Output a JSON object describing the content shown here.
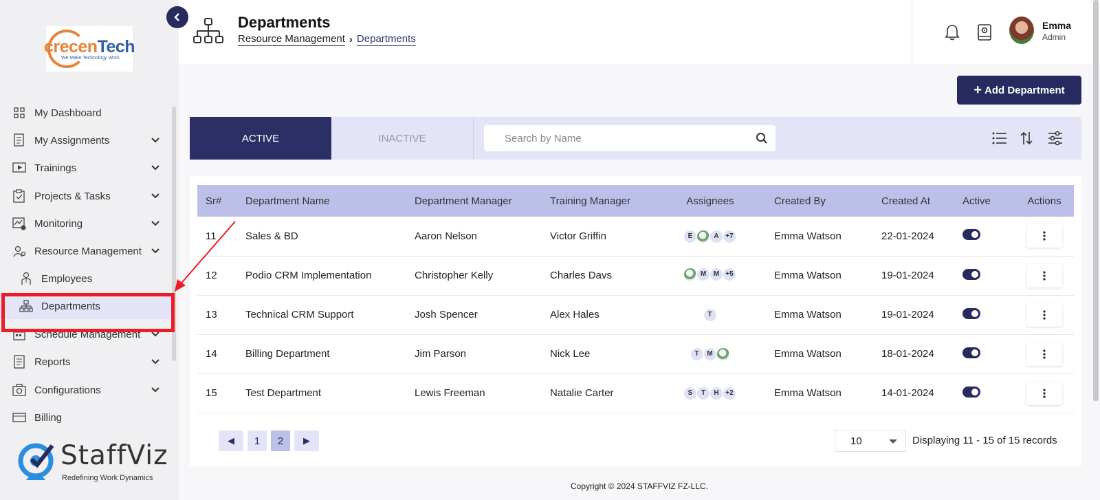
{
  "brand": {
    "logo_primary": "recen",
    "logo_secondary": "Tech",
    "logo_letter": "c",
    "logo_tagline": "We Make Technology Work",
    "footer_brand": "StaffViz",
    "footer_tagline": "Redefining Work Dynamics"
  },
  "sidebar": {
    "items": [
      {
        "label": "My Dashboard",
        "icon": "dashboard-icon",
        "expandable": false
      },
      {
        "label": "My Assignments",
        "icon": "assignments-icon",
        "expandable": true
      },
      {
        "label": "Trainings",
        "icon": "trainings-icon",
        "expandable": true
      },
      {
        "label": "Projects & Tasks",
        "icon": "projects-icon",
        "expandable": true
      },
      {
        "label": "Monitoring",
        "icon": "monitoring-icon",
        "expandable": true
      },
      {
        "label": "Resource Management",
        "icon": "resource-icon",
        "expandable": true
      },
      {
        "label": "Employees",
        "icon": "employee-icon",
        "expandable": false,
        "sub": true
      },
      {
        "label": "Departments",
        "icon": "department-icon",
        "expandable": false,
        "sub": true,
        "active": true
      },
      {
        "label": "Schedule Management",
        "icon": "schedule-icon",
        "expandable": true
      },
      {
        "label": "Reports",
        "icon": "reports-icon",
        "expandable": true
      },
      {
        "label": "Configurations",
        "icon": "configurations-icon",
        "expandable": true
      },
      {
        "label": "Billing",
        "icon": "billing-icon",
        "expandable": false
      }
    ]
  },
  "header": {
    "title": "Departments",
    "breadcrumb": [
      "Resource Management",
      "Departments"
    ],
    "user_name": "Emma",
    "user_role": "Admin"
  },
  "toolbar": {
    "add_label": "Add Department",
    "tab_active": "ACTIVE",
    "tab_inactive": "INACTIVE",
    "search_placeholder": "Search by Name"
  },
  "table": {
    "columns": [
      "Sr#",
      "Department Name",
      "Department Manager",
      "Training Manager",
      "Assignees",
      "Created By",
      "Created At",
      "Active",
      "Actions"
    ],
    "rows": [
      {
        "sr": "11",
        "name": "Sales & BD",
        "dept_manager": "Aaron Nelson",
        "training_manager": "Victor Griffin",
        "assignees": [
          "E",
          "img",
          "A",
          "+7"
        ],
        "created_by": "Emma Watson",
        "created_at": "22-01-2024",
        "active": true
      },
      {
        "sr": "12",
        "name": "Podio CRM Implementation",
        "dept_manager": "Christopher Kelly",
        "training_manager": "Charles Davs",
        "assignees": [
          "img",
          "M",
          "M",
          "+5"
        ],
        "created_by": "Emma Watson",
        "created_at": "19-01-2024",
        "active": true
      },
      {
        "sr": "13",
        "name": "Technical CRM Support",
        "dept_manager": "Josh Spencer",
        "training_manager": "Alex Hales",
        "assignees": [
          "T"
        ],
        "created_by": "Emma Watson",
        "created_at": "19-01-2024",
        "active": true
      },
      {
        "sr": "14",
        "name": "Billing Department",
        "dept_manager": "Jim Parson",
        "training_manager": "Nick Lee",
        "assignees": [
          "T",
          "M",
          "img"
        ],
        "created_by": "Emma Watson",
        "created_at": "18-01-2024",
        "active": true
      },
      {
        "sr": "15",
        "name": "Test Department",
        "dept_manager": "Lewis Freeman",
        "training_manager": "Natalie Carter",
        "assignees": [
          "S",
          "T",
          "H",
          "+2"
        ],
        "created_by": "Emma Watson",
        "created_at": "14-01-2024",
        "active": true
      }
    ]
  },
  "pagination": {
    "prev": "◀",
    "next": "▶",
    "pages": [
      "1",
      "2"
    ],
    "current": "2",
    "page_size": "10",
    "info": "Displaying 11 - 15 of 15 records"
  },
  "footer": {
    "copyright": "Copyright © 2024 STAFFVIZ FZ-LLC."
  },
  "colors": {
    "primary": "#262a5e",
    "tab_bg": "#e3e4f7",
    "table_header": "#bcc0e8",
    "highlight": "#ee1c25"
  }
}
